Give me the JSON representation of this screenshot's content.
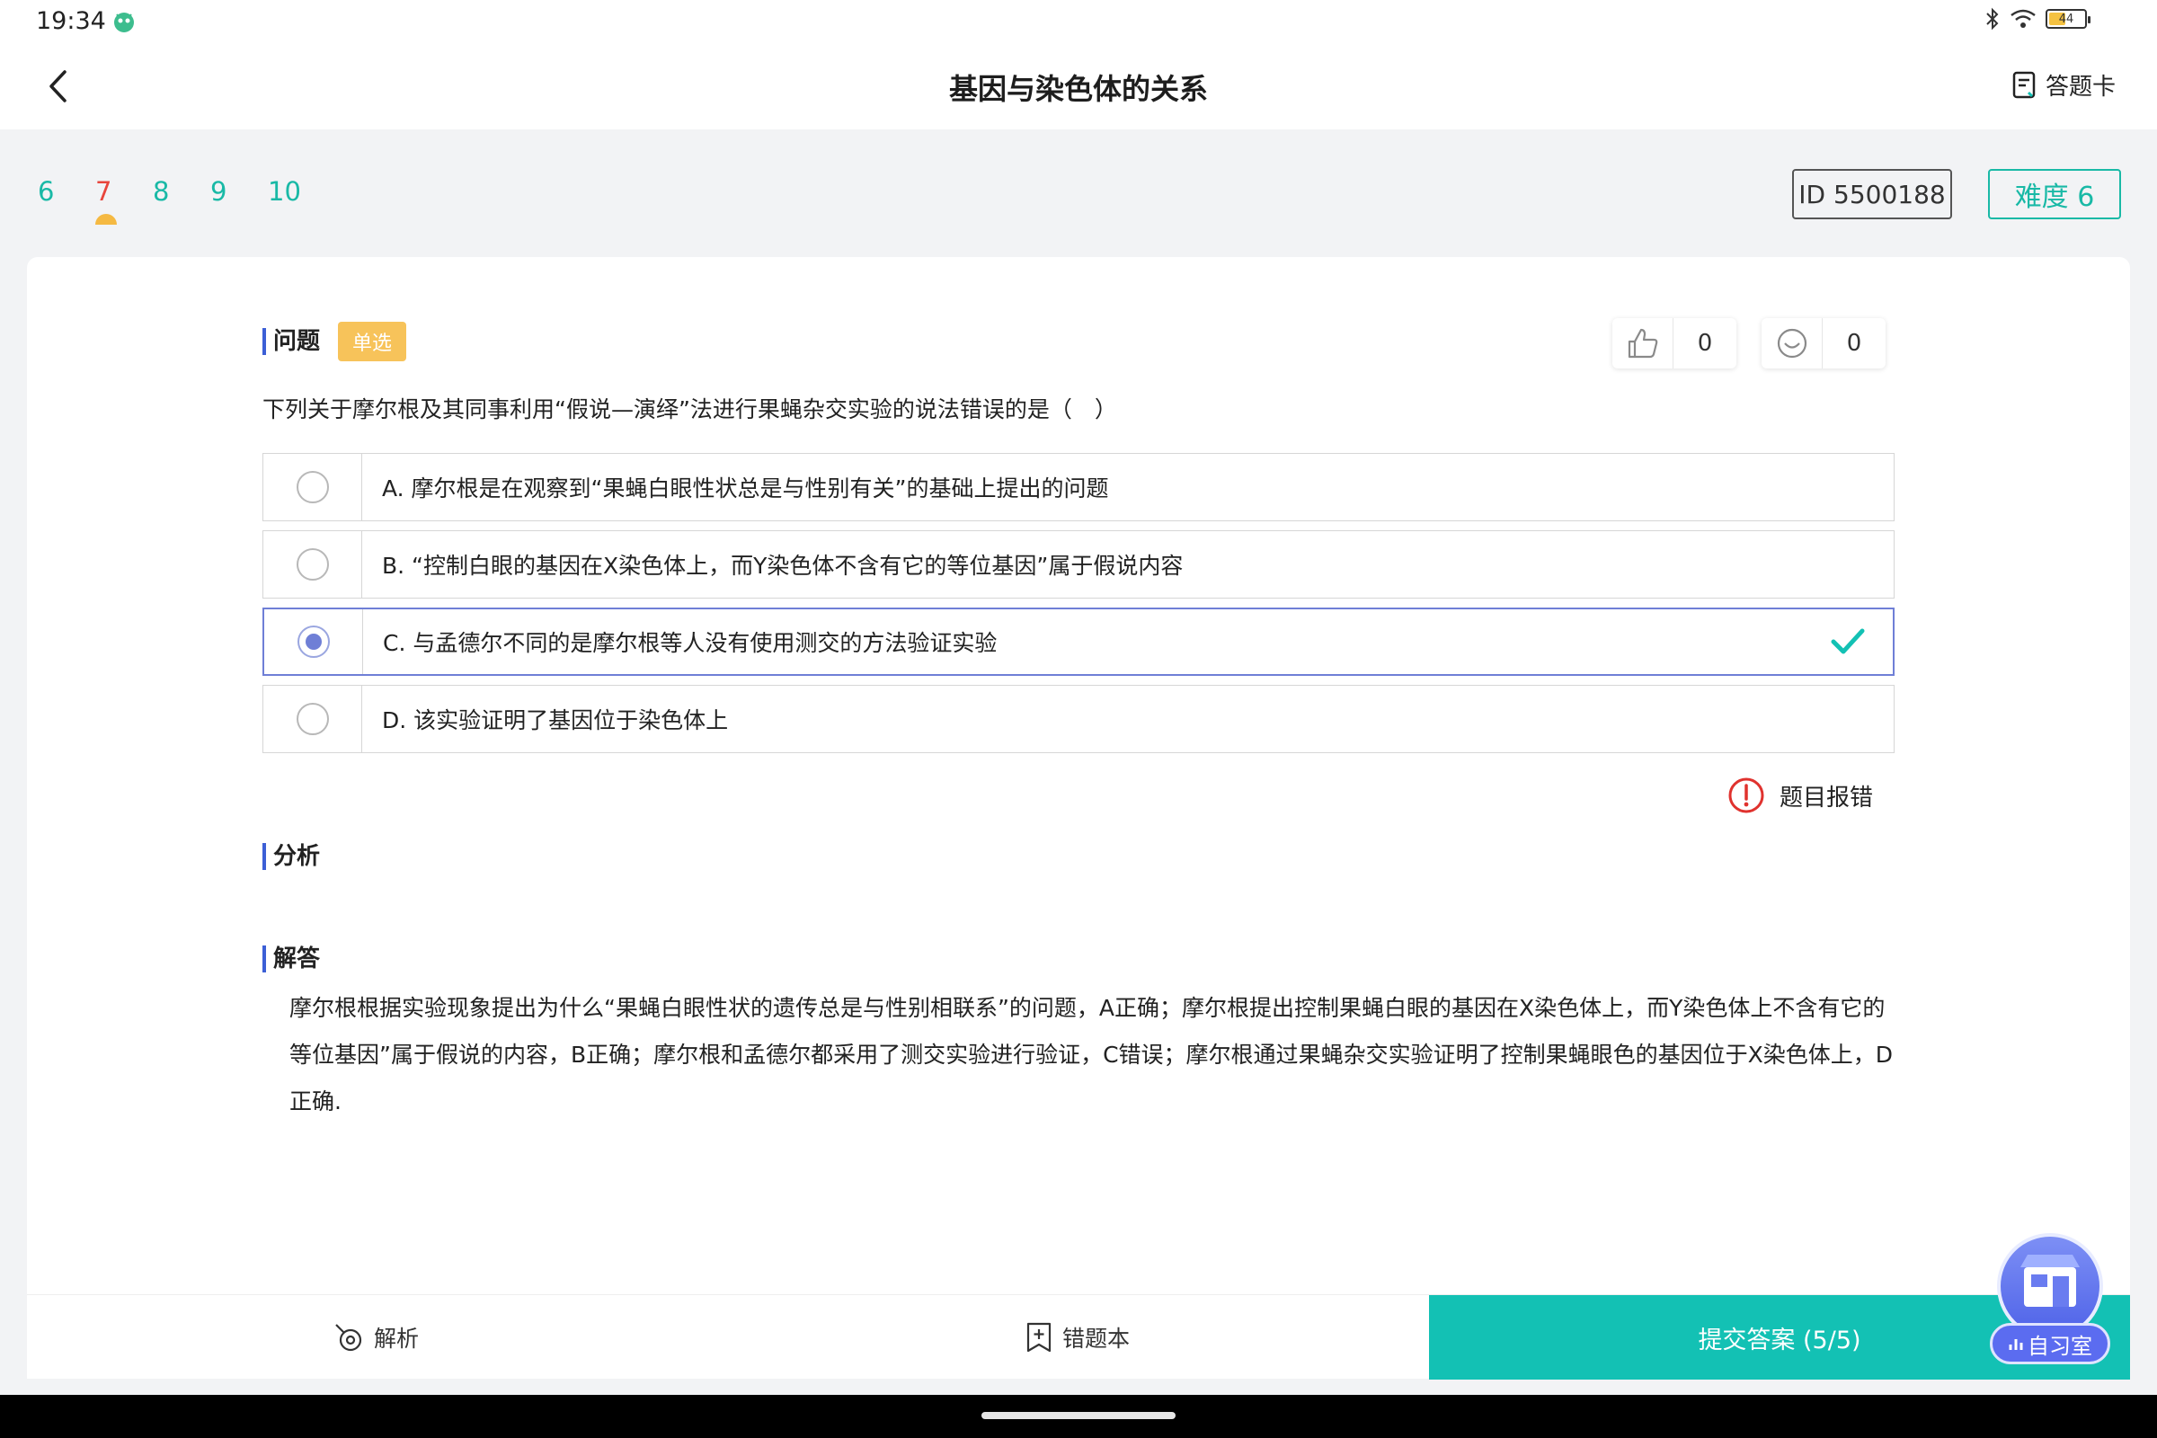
{
  "status_bar": {
    "time": "19:34",
    "battery": "44"
  },
  "header": {
    "title": "基因与染色体的关系",
    "answer_card_label": "答题卡"
  },
  "question_nav": {
    "numbers": [
      "6",
      "7",
      "8",
      "9",
      "10"
    ],
    "current": "7",
    "id_label": "ID 5500188",
    "difficulty_label": "难度 6"
  },
  "question": {
    "section_label": "问题",
    "type_badge": "单选",
    "likes": "0",
    "smiles": "0",
    "stem": "下列关于摩尔根及其同事利用“假说—演绎”法进行果蝇杂交实验的说法错误的是（　）",
    "options": [
      {
        "text": "A. 摩尔根是在观察到“果蝇白眼性状总是与性别有关”的基础上提出的问题",
        "selected": false
      },
      {
        "text": "B. “控制白眼的基因在X染色体上，而Y染色体不含有它的等位基因”属于假说内容",
        "selected": false
      },
      {
        "text": "C. 与孟德尔不同的是摩尔根等人没有使用测交的方法验证实验",
        "selected": true
      },
      {
        "text": "D. 该实验证明了基因位于染色体上",
        "selected": false
      }
    ],
    "report_label": "题目报错"
  },
  "analysis": {
    "section_label": "分析"
  },
  "solution": {
    "section_label": "解答",
    "text": "摩尔根根据实验现象提出为什么“果蝇白眼性状的遗传总是与性别相联系”的问题，A正确；摩尔根提出控制果蝇白眼的基因在X染色体上，而Y染色体上不含有它的等位基因”属于假说的内容，B正确；摩尔根和孟德尔都采用了测交实验进行验证，C错误；摩尔根通过果蝇杂交实验证明了控制果蝇眼色的基因位于X染色体上，D正确."
  },
  "bottom_bar": {
    "analysis_label": "解析",
    "wrongbook_label": "错题本",
    "submit_label": "提交答案 (5/5)"
  },
  "study_room": {
    "label": "自习室"
  },
  "colors": {
    "accent": "#13c1b4",
    "selected_border": "#6f7fd6",
    "current_number": "#e8453c",
    "badge": "#f7c35a"
  }
}
